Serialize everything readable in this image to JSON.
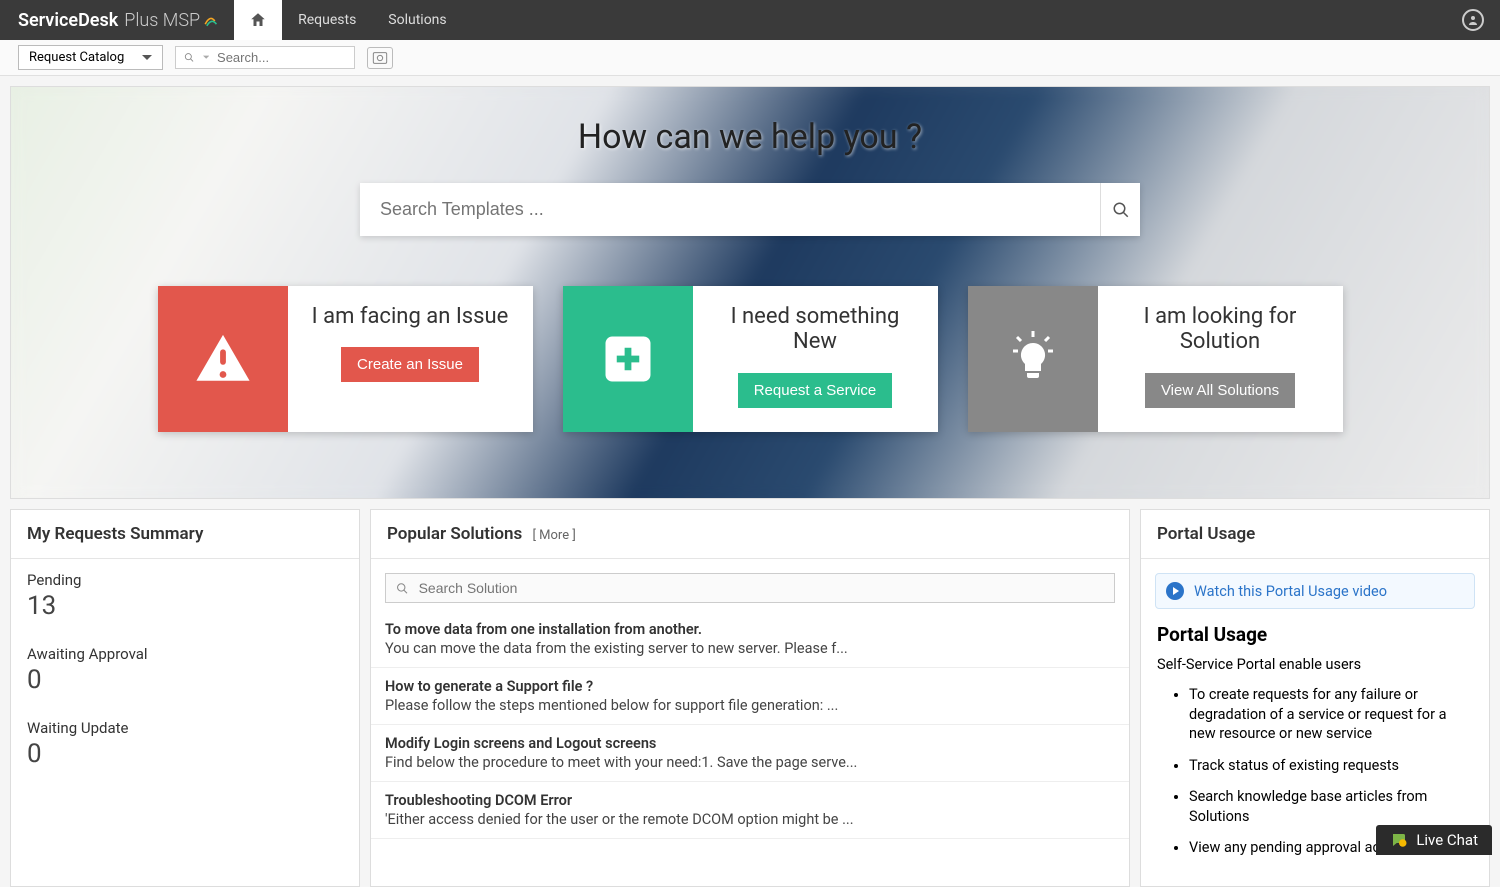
{
  "brand": {
    "bold": "ServiceDesk",
    "light": "Plus MSP"
  },
  "nav": {
    "requests": "Requests",
    "solutions": "Solutions"
  },
  "subbar": {
    "catalog_label": "Request Catalog",
    "search_placeholder": "Search..."
  },
  "hero": {
    "title": "How can we help you ?",
    "search_placeholder": "Search Templates ..."
  },
  "cards": [
    {
      "title": "I am facing an Issue",
      "button": "Create an Issue"
    },
    {
      "title": "I need something New",
      "button": "Request a Service"
    },
    {
      "title": "I am looking for Solution",
      "button": "View All Solutions"
    }
  ],
  "summary": {
    "heading": "My Requests Summary",
    "items": [
      {
        "label": "Pending",
        "value": "13"
      },
      {
        "label": "Awaiting Approval",
        "value": "0"
      },
      {
        "label": "Waiting Update",
        "value": "0"
      }
    ]
  },
  "popular": {
    "heading": "Popular Solutions",
    "more": "[ More ]",
    "search_placeholder": "Search Solution",
    "items": [
      {
        "title": "To move data from one installation from another.",
        "desc": "You can move the data from the existing server to new server. Please f..."
      },
      {
        "title": "How to generate a Support file ?",
        "desc": "Please follow the steps mentioned below for support file generation: ..."
      },
      {
        "title": "Modify Login screens and Logout screens",
        "desc": "Find below the procedure to meet with your need:1. Save the page serve..."
      },
      {
        "title": "Troubleshooting DCOM Error",
        "desc": "'Either access denied for the user or the remote DCOM option might be ..."
      }
    ]
  },
  "portal": {
    "heading": "Portal Usage",
    "video_link": "Watch this Portal Usage video",
    "subheading": "Portal Usage",
    "intro": "Self-Service Portal enable users",
    "bullets": [
      "To create requests for any failure or degradation of a service or request for a new resource or new service",
      "Track status of existing requests",
      "Search knowledge base articles from Solutions",
      "View any pending approval ac"
    ]
  },
  "livechat": "Live Chat"
}
